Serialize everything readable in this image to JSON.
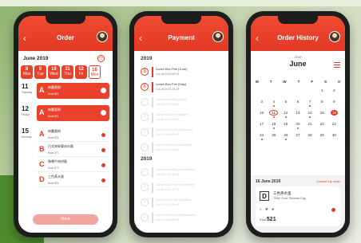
{
  "order": {
    "title": "Order",
    "month": "June 2019",
    "days": [
      {
        "num": "8",
        "wd": "Mon"
      },
      {
        "num": "9",
        "wd": "Tue"
      },
      {
        "num": "10",
        "wd": "Wed"
      },
      {
        "num": "11",
        "wd": "Thu"
      },
      {
        "num": "12",
        "wd": "Fri"
      },
      {
        "num": "16",
        "wd": "Mon"
      }
    ],
    "rows": [
      {
        "date": "11",
        "sub": "Tuesday",
        "cards": [
          {
            "letter": "A",
            "name": "肉醬意粉",
            "kcal": "Kcal 521",
            "selected": true
          }
        ]
      },
      {
        "date": "12",
        "sub": "Friday",
        "cards": [
          {
            "letter": "A",
            "name": "肉醬意粉",
            "kcal": "Kcal 521",
            "selected": true
          }
        ]
      },
      {
        "date": "15",
        "sub": "Monday",
        "cards": [
          {
            "letter": "A",
            "name": "肉醬意粉",
            "kcal": "Kcal 521"
          },
          {
            "letter": "B",
            "name": "日式肉碎粟米炒飯",
            "kcal": "Kcal 377"
          },
          {
            "letter": "C",
            "name": "咖喱牛肉拼飯",
            "kcal": "Kcal 377"
          },
          {
            "letter": "D",
            "name": "三色蒸水蛋",
            "kcal": "Kcal 521"
          }
        ]
      }
    ],
    "next_label": "Next"
  },
  "payment": {
    "title": "Payment",
    "years": [
      "2019",
      "2019"
    ],
    "items": [
      {
        "title": "Lunch Box Fee (June)",
        "sub": "Cut-off 2019-06-05",
        "done": false
      },
      {
        "title": "Lunch Box Fee (May)",
        "sub": "Cut-off 2019-05-08",
        "done": false
      },
      {
        "title": "Lunch Box Fee (April)",
        "sub": "Cut-off 2019-04-05",
        "done": true
      },
      {
        "title": "Lunch Box Fee (March)",
        "sub": "Cut-off 2019-03-05",
        "done": true
      },
      {
        "title": "Lunch Box Fee (February)",
        "sub": "Cut-off 2019-02-05",
        "done": true
      },
      {
        "title": "Lunch Box Fee (January)",
        "sub": "Cut-off 2019-01-05",
        "done": true
      },
      {
        "title": "Lunch Box Fee (December)",
        "sub": "Cut-off 2018-12-05",
        "done": true
      },
      {
        "title": "Lunch Box Fee (November)",
        "sub": "Cut-off 2018-11-05",
        "done": true
      },
      {
        "title": "Lunch Box Fee (October)",
        "sub": "Cut-off 2018-10-05",
        "done": true
      },
      {
        "title": "Lunch Box Fee (September)",
        "sub": "Cut-off 2018-09-05",
        "done": true
      }
    ]
  },
  "history": {
    "title": "Order History",
    "year": "2019",
    "month": "June",
    "weekdays": [
      "M",
      "T",
      "W",
      "T",
      "F",
      "S",
      "S"
    ],
    "cells": [
      "",
      "",
      "",
      "",
      "",
      "1",
      "2",
      "3",
      "4",
      "5",
      "6",
      "7",
      "8",
      "9",
      "10",
      "11",
      "12",
      "13",
      "14",
      "15",
      "16",
      "17",
      "18",
      "19",
      "20",
      "21",
      "22",
      "23",
      "24",
      "25",
      "26",
      "27",
      "28",
      "29",
      "30"
    ],
    "dotted_days": [
      "4",
      "7",
      "11",
      "12",
      "14",
      "18",
      "20",
      "24",
      "26"
    ],
    "selected_day": "16",
    "today_day": "11",
    "detail_date": "16 June 2019",
    "cancel_label": "Cancel my order",
    "dish_letter": "D",
    "dish_name": "三色蒸水蛋",
    "dish_name_en": "Three Color Steamed Egg",
    "kcal_label": "Kcal",
    "kcal_value": "521"
  }
}
